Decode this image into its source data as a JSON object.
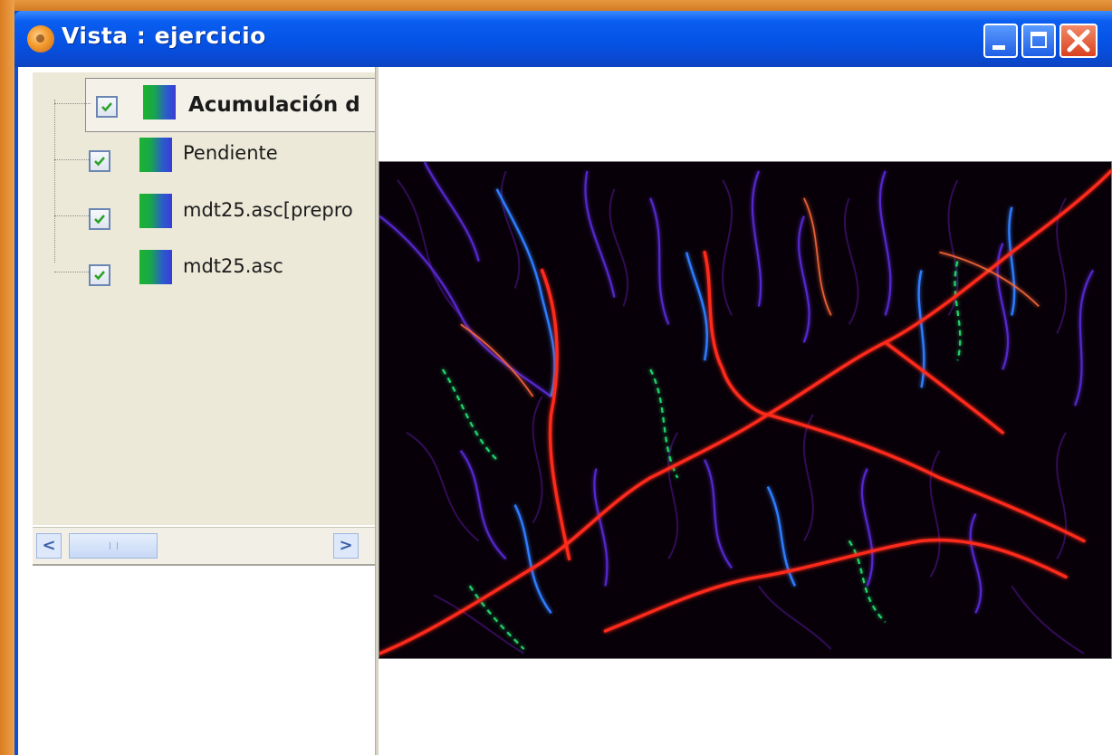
{
  "window": {
    "title": "Vista : ejercicio",
    "controls": {
      "minimize": "minimize",
      "maximize": "maximize",
      "close": "close"
    }
  },
  "toc": {
    "layers": [
      {
        "label": "Acumulación d",
        "checked": true,
        "selected": true
      },
      {
        "label": "Pendiente",
        "checked": true,
        "selected": false
      },
      {
        "label": "mdt25.asc[prepro",
        "checked": true,
        "selected": false
      },
      {
        "label": "mdt25.asc",
        "checked": true,
        "selected": false
      }
    ],
    "scrollbar": {
      "left_arrow": "<",
      "right_arrow": ">"
    }
  },
  "map": {
    "description_colors": {
      "background": "#080008",
      "channel_main": "#ff2a1a",
      "channel_mid": "#2f7dff",
      "channel_minor": "#7b1fd9",
      "accent": "#22d36b"
    }
  },
  "colors": {
    "titlebar": "#0553e6",
    "panel": "#ece9d8",
    "desktop": "#e08a2c"
  }
}
